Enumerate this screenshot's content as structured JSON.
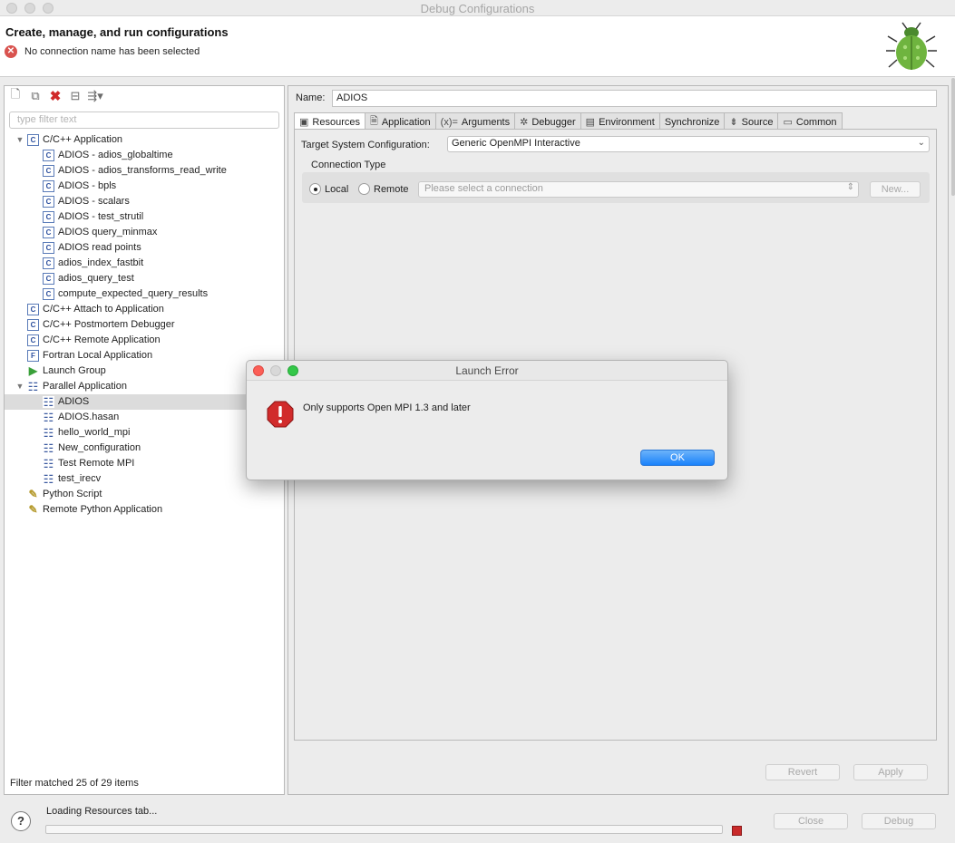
{
  "window": {
    "title": "Debug Configurations"
  },
  "header": {
    "title": "Create, manage, and run configurations",
    "error": "No connection name has been selected"
  },
  "left": {
    "filter_placeholder": "type filter text",
    "status": "Filter matched 25 of 29 items",
    "tree": [
      {
        "label": "C/C++ Application",
        "level": 0,
        "expanded": true,
        "icon": "c-config-icon"
      },
      {
        "label": "ADIOS - adios_globaltime",
        "level": 1,
        "icon": "c-config-icon"
      },
      {
        "label": "ADIOS - adios_transforms_read_write",
        "level": 1,
        "icon": "c-config-icon"
      },
      {
        "label": "ADIOS - bpls",
        "level": 1,
        "icon": "c-config-icon"
      },
      {
        "label": "ADIOS - scalars",
        "level": 1,
        "icon": "c-config-icon"
      },
      {
        "label": "ADIOS - test_strutil",
        "level": 1,
        "icon": "c-config-icon"
      },
      {
        "label": "ADIOS query_minmax",
        "level": 1,
        "icon": "c-config-icon"
      },
      {
        "label": "ADIOS read points",
        "level": 1,
        "icon": "c-config-icon"
      },
      {
        "label": "adios_index_fastbit",
        "level": 1,
        "icon": "c-config-icon"
      },
      {
        "label": "adios_query_test",
        "level": 1,
        "icon": "c-config-icon"
      },
      {
        "label": "compute_expected_query_results",
        "level": 1,
        "icon": "c-config-icon"
      },
      {
        "label": "C/C++ Attach to Application",
        "level": 0,
        "icon": "c-config-icon"
      },
      {
        "label": "C/C++ Postmortem Debugger",
        "level": 0,
        "icon": "c-config-icon"
      },
      {
        "label": "C/C++ Remote Application",
        "level": 0,
        "icon": "c-config-icon"
      },
      {
        "label": "Fortran Local Application",
        "level": 0,
        "icon": "fortran-config-icon"
      },
      {
        "label": "Launch Group",
        "level": 0,
        "icon": "launch-group-icon"
      },
      {
        "label": "Parallel Application",
        "level": 0,
        "expanded": true,
        "icon": "parallel-config-icon"
      },
      {
        "label": "ADIOS",
        "level": 1,
        "selected": true,
        "icon": "parallel-config-icon"
      },
      {
        "label": "ADIOS.hasan",
        "level": 1,
        "icon": "parallel-config-icon"
      },
      {
        "label": "hello_world_mpi",
        "level": 1,
        "icon": "parallel-config-icon"
      },
      {
        "label": "New_configuration",
        "level": 1,
        "icon": "parallel-config-icon"
      },
      {
        "label": "Test Remote MPI",
        "level": 1,
        "icon": "parallel-config-icon"
      },
      {
        "label": "test_irecv",
        "level": 1,
        "icon": "parallel-config-icon"
      },
      {
        "label": "Python Script",
        "level": 0,
        "icon": "python-config-icon"
      },
      {
        "label": "Remote Python Application",
        "level": 0,
        "icon": "python-config-icon"
      }
    ]
  },
  "right": {
    "name_label": "Name:",
    "name_value": "ADIOS",
    "tabs": [
      {
        "label": "Resources",
        "icon": "resources-icon",
        "active": true
      },
      {
        "label": "Application",
        "icon": "application-icon"
      },
      {
        "label": "Arguments",
        "icon": "arguments-icon"
      },
      {
        "label": "Debugger",
        "icon": "debugger-icon"
      },
      {
        "label": "Environment",
        "icon": "environment-icon"
      },
      {
        "label": "Synchronize",
        "icon": ""
      },
      {
        "label": "Source",
        "icon": "source-icon"
      },
      {
        "label": "Common",
        "icon": "common-icon"
      }
    ],
    "tsc_label": "Target System Configuration:",
    "tsc_value": "Generic OpenMPI Interactive",
    "connection_type_label": "Connection Type",
    "local_label": "Local",
    "remote_label": "Remote",
    "connection_placeholder": "Please select a connection",
    "new_label": "New...",
    "revert_label": "Revert",
    "apply_label": "Apply"
  },
  "footer": {
    "loading": "Loading Resources tab...",
    "progress": 0,
    "close_label": "Close",
    "debug_label": "Debug",
    "help_label": "?"
  },
  "dialog": {
    "title": "Launch Error",
    "message": "Only supports Open MPI 1.3 and later",
    "ok_label": "OK"
  },
  "colors": {
    "accent": "#1a82fb",
    "error": "#d9534f",
    "selection": "#dcdcdc"
  }
}
